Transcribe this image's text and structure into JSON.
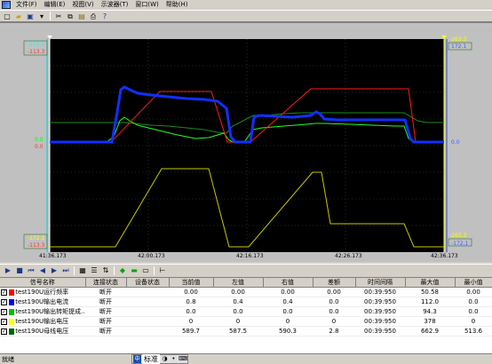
{
  "menu": [
    "文件(F)",
    "编辑(E)",
    "视图(V)",
    "示波器(T)",
    "窗口(W)",
    "帮助(H)"
  ],
  "toolbar_icons": [
    "new-icon",
    "open-icon",
    "save-icon",
    "dropdown-icon",
    "cut-icon",
    "copy-icon",
    "paste-icon",
    "print-icon",
    "help-icon"
  ],
  "plot": {
    "left_labels": {
      "top_cyan": "172.1",
      "top_red": "-113.3",
      "mid_green": "0.0",
      "mid_red": "0.0",
      "bot_yellow": "-172.1",
      "bot_red": "-113.3"
    },
    "right_labels": {
      "top_yellow": "-263.3",
      "top_blue": "172.1",
      "mid_blue": "0.0",
      "bot_yellow": "-263.3",
      "bot_blue": "-172.1"
    },
    "x_ticks": [
      "41:36.173",
      "42:00.173",
      "42:16.173",
      "42:26.173",
      "42:36.173"
    ]
  },
  "table": {
    "headers": [
      "信号名称",
      "连接状态",
      "设备状态",
      "当前值",
      "左值",
      "右值",
      "差额",
      "时间间隔",
      "最大值",
      "最小值"
    ],
    "rows": [
      {
        "color": "#ff0000",
        "name": "test190U运行频率",
        "conn": "断开",
        "dev": "",
        "cur": "0.00",
        "left": "0.00",
        "right": "0.00",
        "diff": "0.00",
        "interval": "00:39:950",
        "max": "50.58",
        "min": "0.00"
      },
      {
        "color": "#0000ff",
        "name": "test190U输出电流",
        "conn": "断开",
        "dev": "",
        "cur": "0.8",
        "left": "0.4",
        "right": "0.4",
        "diff": "0.0",
        "interval": "00:39:950",
        "max": "112.0",
        "min": "0.0"
      },
      {
        "color": "#00c000",
        "name": "test190U输出转矩提成...",
        "conn": "断开",
        "dev": "",
        "cur": "0.0",
        "left": "0.0",
        "right": "0.0",
        "diff": "0.0",
        "interval": "00:39:950",
        "max": "94.3",
        "min": "0.0"
      },
      {
        "color": "#ffff00",
        "name": "test190U输出电压",
        "conn": "断开",
        "dev": "",
        "cur": "0",
        "left": "0",
        "right": "0",
        "diff": "0",
        "interval": "00:39:950",
        "max": "378",
        "min": "0"
      },
      {
        "color": "#006400",
        "name": "test190U母线电压",
        "conn": "断开",
        "dev": "",
        "cur": "589.7",
        "left": "587.5",
        "right": "590.3",
        "diff": "2.8",
        "interval": "00:39:950",
        "max": "662.9",
        "min": "513.6"
      }
    ]
  },
  "status": {
    "text": "就绪",
    "ime_label": "标准"
  }
}
